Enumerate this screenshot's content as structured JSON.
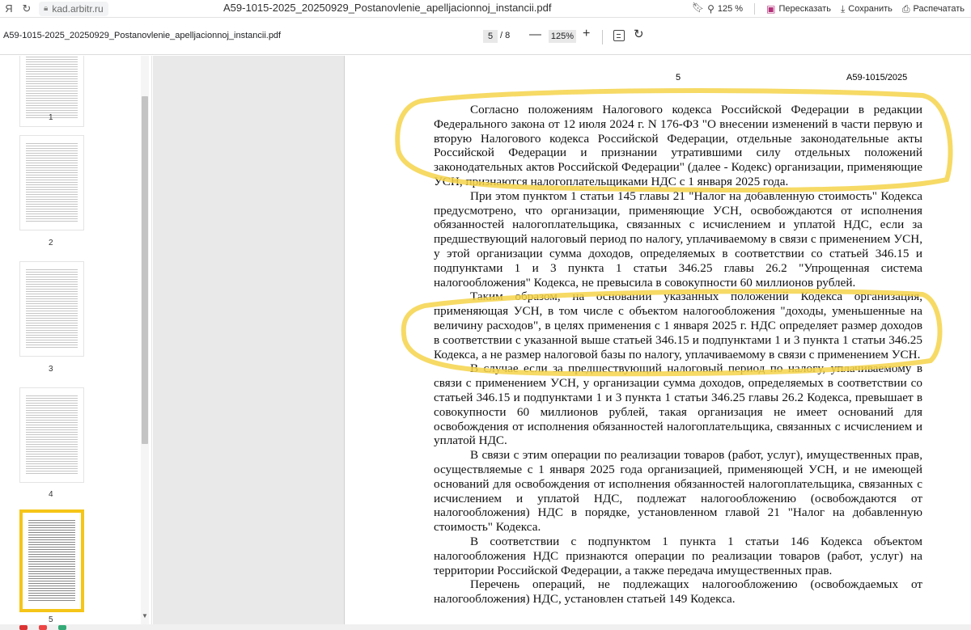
{
  "browser": {
    "address": "kad.arbitr.ru",
    "tab_title": "A59-1015-2025_20250929_Postanovlenie_apelljacionnoj_instancii.pdf",
    "zoom": "125 %",
    "share_label": "Пересказать",
    "save_label": "Сохранить",
    "print_label": "Распечатать"
  },
  "pdf_toolbar": {
    "filename": "A59-1015-2025_20250929_Postanovlenie_apelljacionnoj_instancii.pdf",
    "current_page": "5",
    "total_pages": "/ 8",
    "zoom": "125%"
  },
  "sidebar": {
    "thumbnails": [
      {
        "label": "1"
      },
      {
        "label": "2"
      },
      {
        "label": "3"
      },
      {
        "label": "4"
      },
      {
        "label": "5",
        "selected": true
      }
    ]
  },
  "page": {
    "number": "5",
    "case_number": "А59-1015/2025",
    "paragraphs": [
      "Согласно положениям Налогового кодекса Российской Федерации в редакции Федерального закона от 12 июля 2024 г. N 176-ФЗ \"О внесении изменений в части первую и вторую Налогового кодекса Российской Федерации, отдельные законодательные акты Российской Федерации и признании утратившими силу отдельных положений законодательных актов Российской Федерации\" (далее - Кодекс) организации, применяющие УСН, признаются налогоплательщиками НДС с 1 января 2025 года.",
      "При этом пунктом 1 статьи 145 главы 21 \"Налог на добавленную стоимость\" Кодекса предусмотрено, что организации, применяющие УСН, освобождаются от исполнения обязанностей налогоплательщика, связанных с исчислением и уплатой НДС, если за предшествующий налоговый период по налогу, уплачиваемому в связи с применением УСН, у этой организации сумма доходов, определяемых в соответствии со статьей 346.15 и подпунктами 1 и 3 пункта 1 статьи 346.25 главы 26.2 \"Упрощенная система налогообложения\" Кодекса, не превысила в совокупности 60 миллионов рублей.",
      "Таким образом, на основании указанных положений Кодекса организация, применяющая УСН, в том числе с объектом налогообложения \"доходы, уменьшенные на величину расходов\", в целях применения с 1 января 2025 г. НДС определяет размер доходов в соответствии с указанной выше статьей 346.15 и подпунктами 1 и 3 пункта 1 статьи 346.25 Кодекса, а не размер налоговой базы по налогу, уплачиваемому в связи с применением УСН.",
      "В случае если за предшествующий налоговый период по налогу, уплачиваемому в связи с применением УСН, у организации сумма доходов, определяемых в соответствии со статьей 346.15 и подпунктами 1 и 3 пункта 1 статьи 346.25 главы 26.2 Кодекса, превышает в совокупности 60 миллионов рублей, такая организация не имеет оснований для освобождения от исполнения обязанностей налогоплательщика, связанных с исчислением и уплатой НДС.",
      "В связи с этим операции по реализации товаров (работ, услуг), имущественных прав, осуществляемые с 1 января 2025 года организацией, применяющей УСН, и не имеющей оснований для освобождения от исполнения обязанностей налогоплательщика, связанных с исчислением и уплатой НДС, подлежат налогообложению (освобождаются от налогообложения) НДС в порядке, установленном главой 21 \"Налог на добавленную стоимость\" Кодекса.",
      "В соответствии с подпунктом 1 пункта 1 статьи 146 Кодекса объектом налогообложения НДС признаются операции по реализации товаров (работ, услуг) на территории Российской Федерации, а также передача имущественных прав.",
      "Перечень операций, не подлежащих налогообложению (освобождаемых от налогообложения) НДС, установлен статьей 149 Кодекса."
    ]
  },
  "colors": {
    "highlight": "#f5d44a",
    "selected_thumb": "#f5c518"
  }
}
